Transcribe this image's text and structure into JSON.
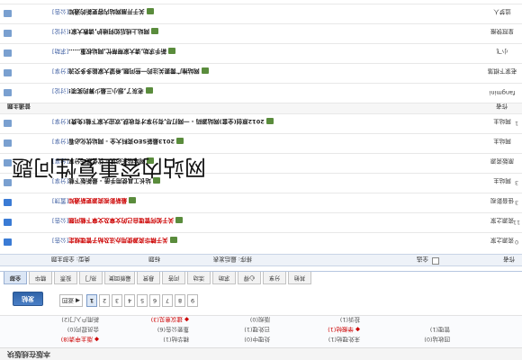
{
  "header": {
    "title": "本版在线版块"
  },
  "stats": [
    {
      "label": "版主申请(8)",
      "hot": true,
      "name": "moderator-apply"
    },
    {
      "label": "会员提问(0)",
      "name": "member-question"
    },
    {
      "label": "新用户入门(2)",
      "name": "newbie"
    },
    {
      "label": "精华帖(1)",
      "name": "digest"
    },
    {
      "label": "重要公告(6)",
      "name": "notice"
    },
    {
      "label": "建议意见(3)",
      "hot": true,
      "name": "suggest"
    },
    {
      "label": "处理中(0)",
      "name": "processing"
    },
    {
      "label": "已处理(1)",
      "name": "done"
    },
    {
      "label": "版规(0)",
      "name": "rules"
    },
    {
      "label": "未处理帖(1)",
      "name": "pending"
    },
    {
      "label": "举报帖(1)",
      "hot": true,
      "name": "report"
    },
    {
      "label": "投诉(1)",
      "name": "complain"
    },
    {
      "label": "回收站(0)",
      "name": "recycle"
    },
    {
      "label": "管理(1)",
      "name": "manage"
    }
  ],
  "pager": {
    "pages": [
      "1",
      "2",
      "3",
      "4",
      "5",
      "6",
      "7",
      "8",
      "9"
    ],
    "current": "1",
    "prev": "◀ 返回",
    "new_label": "发帖",
    "next": "下一页"
  },
  "tabs": [
    "全部",
    "精华",
    "投票",
    "热门",
    "最新回复",
    "悬赏",
    "问答",
    "活动",
    "求助",
    "心得",
    "分享",
    "其他"
  ],
  "table": {
    "select_all": "全选",
    "col_author": "作者",
    "col_replies": "回复",
    "col_title": "标题",
    "col_sort": "排序: 最后发表",
    "col_filter": "时间: 最新发表",
    "col_all": "全部时间",
    "col_type": "类型: 全部主题"
  },
  "rows": [
    {
      "author": "资源之家",
      "replies": "0",
      "title": "关于精华资源使用办法及帖子管理规定",
      "tag": "[公告]",
      "hot": true
    },
    {
      "author": "资源之家",
      "replies": "11",
      "title": "关于如何管理自己的文章及文章下载问题",
      "tag": "[公告]",
      "hot": true
    },
    {
      "author": "佳音影视",
      "replies": "3",
      "title": "最新影视资源更新通知",
      "tag": "[置顶]",
      "hot": true
    },
    {
      "author": "网站主",
      "replies": "3",
      "title": "站长工具使用手册 - 最新版下载",
      "tag": "[分享]"
    },
    {
      "author": "原版资源",
      "replies": "",
      "title": "网站站长必读 - 优化技巧分享",
      "tag": "[分享]"
    },
    {
      "author": "网站主",
      "replies": "",
      "title": "2013最新SEO资料大全 - 网站优化必看",
      "tag": "[分享]"
    },
    {
      "author": "网站主",
      "replies": "1",
      "title": "2012原创(全套)网站源码 - 一网打尽,有分享才有收获,欢迎大家下载(免费)",
      "tag": "[分享]"
    }
  ],
  "section": {
    "label": "普通主题",
    "left": "作者"
  },
  "rows2": [
    {
      "author": "fangmini",
      "replies": "",
      "title": "老灰了,想小三最少算的奖项!",
      "tag": "[讨论]"
    },
    {
      "author": "老家下棋落",
      "replies": "",
      "title": "网站推广需要关注的一些问题,希望大家能多多交流",
      "tag": "[分享]"
    },
    {
      "author": "小飞",
      "replies": "",
      "title": "新手求助,请大家帮帮忙,网站权重……",
      "tag": "[求助]"
    },
    {
      "author": "皇冠快报",
      "replies": "",
      "title": "网站上线后如何维护,请教大家!",
      "tag": "[讨论]"
    },
    {
      "author": "追梦人",
      "replies": "",
      "title": "关于开展网站内容更新的通知",
      "tag": "[公告]"
    },
    {
      "author": "巴, 林语",
      "replies": "",
      "title": "关于小站如何做好站内优化,让网站排名更快提升!!!",
      "tag": "[讨论]"
    },
    {
      "author": "小小梦想",
      "replies": "",
      "title": "如何做好网站外链建设,让网站快速收录?",
      "tag": "[讨论]"
    }
  ],
  "watermark": "网站内容重复性问题"
}
